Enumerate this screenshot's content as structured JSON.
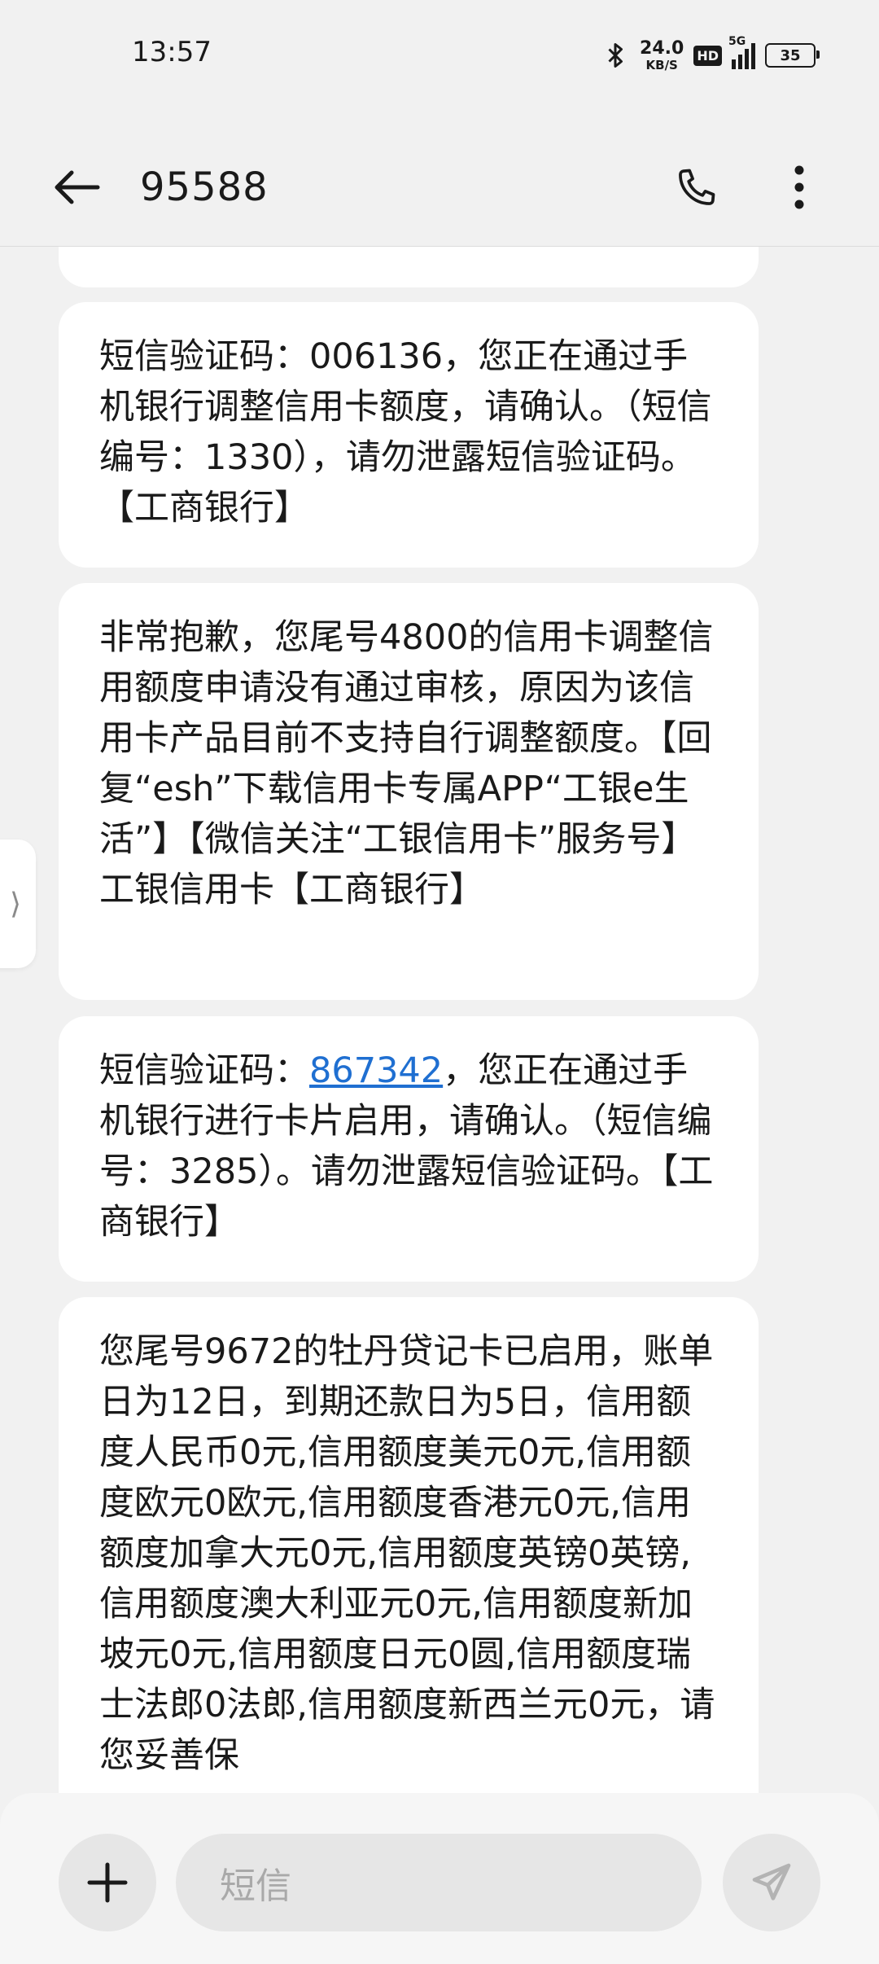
{
  "status_bar": {
    "time": "13:57",
    "net_speed": "24.0",
    "net_speed_unit": "KB/S",
    "hd_label": "HD",
    "network_type": "5G",
    "battery": "35",
    "icons": [
      "bluetooth-icon",
      "hd-icon",
      "signal-icon",
      "battery-icon"
    ]
  },
  "header": {
    "title": "95588",
    "icons": [
      "back-arrow-icon",
      "phone-icon",
      "more-vertical-icon"
    ]
  },
  "messages": [
    {
      "text_before": "短信验证码：006136，您正在通过手机银行调整信用卡额度，请确认。（短信编号：1330），请勿泄露短信验证码。【工商银行】"
    },
    {
      "text_before": "非常抱歉，您尾号4800的信用卡调整信用额度申请没有通过审核，原因为该信用卡产品目前不支持自行调整额度。【回复“esh”下载信用卡专属APP“工银e生活”】【微信关注“工银信用卡”服务号】工银信用卡【工商银行】"
    },
    {
      "text_before": "短信验证码：",
      "code": "867342",
      "text_after": "，您正在通过手机银行进行卡片启用，请确认。（短信编号：3285）。请勿泄露短信验证码。【工商银行】"
    },
    {
      "text_before": "您尾号9672的牡丹贷记卡已启用，账单日为12日，到期还款日为5日，信用额度人民币0元,信用额度美元0元,信用额度欧元0欧元,信用额度香港元0元,信用额度加拿大元0元,信用额度英镑0英镑,信用额度澳大利亚元0元,信用额度新加坡元0元,信用额度日元0圆,信用额度瑞士法郎0法郎,信用额度新西兰元0元，请您妥善保"
    }
  ],
  "side_handle_glyph": "⟩",
  "input_bar": {
    "placeholder": "短信",
    "icons": [
      "plus-icon",
      "send-icon"
    ]
  }
}
